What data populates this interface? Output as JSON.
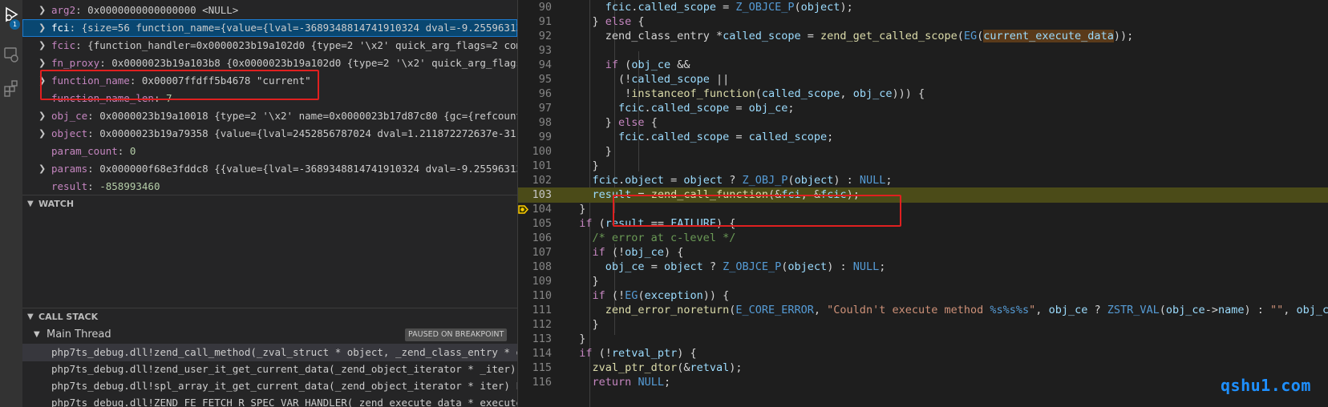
{
  "activity_bar": {
    "debug_badge_count": "1",
    "icons": [
      "run-debug-icon",
      "remote-explorer-icon",
      "extensions-icon"
    ]
  },
  "variables": [
    {
      "name": "arg2",
      "value": "0x0000000000000000 <NULL>",
      "expandable": true,
      "selected": false
    },
    {
      "name": "fci",
      "value": "{size=56 function_name={value={lval=-3689348814741910324 dval=-9.2559631349…",
      "expandable": true,
      "selected": true
    },
    {
      "name": "fcic",
      "value": "{function_handler=0x0000023b19a102d0 {type=2 '\\x2' quick_arg_flags=2 commo…",
      "expandable": true,
      "selected": false
    },
    {
      "name": "fn_proxy",
      "value": "0x0000023b19a103b8 {0x0000023b19a102d0 {type=2 '\\x2' quick_arg_flags=2…",
      "expandable": true,
      "selected": false
    },
    {
      "name": "function_name",
      "value": "0x00007ffdff5b4678 \"current\"",
      "expandable": true,
      "selected": false
    },
    {
      "name": "function_name_len",
      "value": "7",
      "expandable": false,
      "selected": false
    },
    {
      "name": "obj_ce",
      "value": "0x0000023b19a10018 {type=2 '\\x2' name=0x0000023b17d87c80 {gc={refcount=1…",
      "expandable": true,
      "selected": false
    },
    {
      "name": "object",
      "value": "0x0000023b19a79358 {value={lval=2452856787024 dval=1.211872272637e-311#D…",
      "expandable": true,
      "selected": false
    },
    {
      "name": "param_count",
      "value": "0",
      "expandable": false,
      "selected": false
    },
    {
      "name": "params",
      "value": "0x000000f68e3fddc8 {{value={lval=-3689348814741910324 dval=-9.2559631349…",
      "expandable": true,
      "selected": false
    },
    {
      "name": "result",
      "value": "-858993460",
      "expandable": false,
      "selected": false
    }
  ],
  "watch": {
    "title": "WATCH"
  },
  "call_stack": {
    "title": "CALL STACK",
    "thread": "Main Thread",
    "paused_label": "PAUSED ON BREAKPOINT",
    "frames": [
      "php7ts_debug.dll!zend_call_method(_zval_struct * object, _zend_class_entry * obj_",
      "php7ts_debug.dll!zend_user_it_get_current_data(_zend_object_iterator * _iter) Lin",
      "php7ts_debug.dll!spl_array_it_get_current_data(_zend_object_iterator * iter) Line",
      "php7ts_debug.dll!ZEND_FE_FETCH_R_SPEC_VAR_HANDLER(_zend_execute_data * execute_da"
    ]
  },
  "editor": {
    "current_line": 103,
    "lines": [
      {
        "n": 90,
        "indent": 6,
        "tokens": [
          [
            "id",
            "fcic"
          ],
          [
            "p",
            "."
          ],
          [
            "id",
            "called_scope"
          ],
          [
            "p",
            " = "
          ],
          [
            "mac",
            "Z_OBJCE_P"
          ],
          [
            "p",
            "("
          ],
          [
            "id",
            "object"
          ],
          [
            "p",
            ");"
          ]
        ]
      },
      {
        "n": 91,
        "indent": 4,
        "tokens": [
          [
            "p",
            "} "
          ],
          [
            "kw",
            "else"
          ],
          [
            "p",
            " {"
          ]
        ]
      },
      {
        "n": 92,
        "indent": 6,
        "tokens": [
          [
            "p",
            "zend_class_entry "
          ],
          [
            "p",
            "*"
          ],
          [
            "id",
            "called_scope"
          ],
          [
            "p",
            " = "
          ],
          [
            "fn",
            "zend_get_called_scope"
          ],
          [
            "p",
            "("
          ],
          [
            "mac",
            "EG"
          ],
          [
            "p",
            "("
          ],
          [
            "hlid",
            "current_execute_data"
          ],
          [
            "p",
            "));"
          ]
        ]
      },
      {
        "n": 93,
        "indent": 0,
        "tokens": []
      },
      {
        "n": 94,
        "indent": 6,
        "tokens": [
          [
            "kw",
            "if"
          ],
          [
            "p",
            " ("
          ],
          [
            "id",
            "obj_ce"
          ],
          [
            "p",
            " &&"
          ]
        ]
      },
      {
        "n": 95,
        "indent": 8,
        "tokens": [
          [
            "p",
            "(!"
          ],
          [
            "id",
            "called_scope"
          ],
          [
            "p",
            " ||"
          ]
        ]
      },
      {
        "n": 96,
        "indent": 9,
        "tokens": [
          [
            "p",
            "!"
          ],
          [
            "fn",
            "instanceof_function"
          ],
          [
            "p",
            "("
          ],
          [
            "id",
            "called_scope"
          ],
          [
            "p",
            ", "
          ],
          [
            "id",
            "obj_ce"
          ],
          [
            "p",
            "))) {"
          ]
        ]
      },
      {
        "n": 97,
        "indent": 8,
        "tokens": [
          [
            "id",
            "fcic"
          ],
          [
            "p",
            "."
          ],
          [
            "id",
            "called_scope"
          ],
          [
            "p",
            " = "
          ],
          [
            "id",
            "obj_ce"
          ],
          [
            "p",
            ";"
          ]
        ]
      },
      {
        "n": 98,
        "indent": 6,
        "tokens": [
          [
            "p",
            "} "
          ],
          [
            "kw",
            "else"
          ],
          [
            "p",
            " {"
          ]
        ]
      },
      {
        "n": 99,
        "indent": 8,
        "tokens": [
          [
            "id",
            "fcic"
          ],
          [
            "p",
            "."
          ],
          [
            "id",
            "called_scope"
          ],
          [
            "p",
            " = "
          ],
          [
            "id",
            "called_scope"
          ],
          [
            "p",
            ";"
          ]
        ]
      },
      {
        "n": 100,
        "indent": 6,
        "tokens": [
          [
            "p",
            "}"
          ]
        ]
      },
      {
        "n": 101,
        "indent": 4,
        "tokens": [
          [
            "p",
            "}"
          ]
        ]
      },
      {
        "n": 102,
        "indent": 4,
        "tokens": [
          [
            "id",
            "fcic"
          ],
          [
            "p",
            "."
          ],
          [
            "id",
            "object"
          ],
          [
            "p",
            " = "
          ],
          [
            "id",
            "object"
          ],
          [
            "p",
            " ? "
          ],
          [
            "mac",
            "Z_OBJ_P"
          ],
          [
            "p",
            "("
          ],
          [
            "id",
            "object"
          ],
          [
            "p",
            ") : "
          ],
          [
            "mac",
            "NULL"
          ],
          [
            "p",
            ";"
          ]
        ]
      },
      {
        "n": 103,
        "indent": 4,
        "tokens": [
          [
            "id",
            "result"
          ],
          [
            "p",
            " = "
          ],
          [
            "fn",
            "zend_call_function"
          ],
          [
            "p",
            "(&"
          ],
          [
            "id",
            "fci"
          ],
          [
            "p",
            ", &"
          ],
          [
            "id",
            "fcic"
          ],
          [
            "p",
            ");"
          ]
        ]
      },
      {
        "n": 104,
        "indent": 2,
        "tokens": [
          [
            "p",
            "}"
          ]
        ]
      },
      {
        "n": 105,
        "indent": 2,
        "tokens": [
          [
            "kw",
            "if"
          ],
          [
            "p",
            " ("
          ],
          [
            "id",
            "result"
          ],
          [
            "p",
            " == "
          ],
          [
            "id",
            "FAILURE"
          ],
          [
            "p",
            ") {"
          ]
        ]
      },
      {
        "n": 106,
        "indent": 4,
        "tokens": [
          [
            "cm",
            "/* error at c-level */"
          ]
        ]
      },
      {
        "n": 107,
        "indent": 4,
        "tokens": [
          [
            "kw",
            "if"
          ],
          [
            "p",
            " (!"
          ],
          [
            "id",
            "obj_ce"
          ],
          [
            "p",
            ") {"
          ]
        ]
      },
      {
        "n": 108,
        "indent": 6,
        "tokens": [
          [
            "id",
            "obj_ce"
          ],
          [
            "p",
            " = "
          ],
          [
            "id",
            "object"
          ],
          [
            "p",
            " ? "
          ],
          [
            "mac",
            "Z_OBJCE_P"
          ],
          [
            "p",
            "("
          ],
          [
            "id",
            "object"
          ],
          [
            "p",
            ") : "
          ],
          [
            "mac",
            "NULL"
          ],
          [
            "p",
            ";"
          ]
        ]
      },
      {
        "n": 109,
        "indent": 4,
        "tokens": [
          [
            "p",
            "}"
          ]
        ]
      },
      {
        "n": 110,
        "indent": 4,
        "tokens": [
          [
            "kw",
            "if"
          ],
          [
            "p",
            " (!"
          ],
          [
            "mac",
            "EG"
          ],
          [
            "p",
            "("
          ],
          [
            "id",
            "exception"
          ],
          [
            "p",
            ")) {"
          ]
        ]
      },
      {
        "n": 111,
        "indent": 6,
        "tokens": [
          [
            "fn",
            "zend_error_noreturn"
          ],
          [
            "p",
            "("
          ],
          [
            "mac",
            "E_CORE_ERROR"
          ],
          [
            "p",
            ", "
          ],
          [
            "str",
            "\"Couldn't execute method "
          ],
          [
            "mac",
            "%s%s%s"
          ],
          [
            "str",
            "\""
          ],
          [
            "p",
            ", "
          ],
          [
            "id",
            "obj_ce"
          ],
          [
            "p",
            " ? "
          ],
          [
            "mac",
            "ZSTR_VAL"
          ],
          [
            "p",
            "("
          ],
          [
            "id",
            "obj_ce"
          ],
          [
            "p",
            "->"
          ],
          [
            "id",
            "name"
          ],
          [
            "p",
            ") : "
          ],
          [
            "str",
            "\"\""
          ],
          [
            "p",
            ", "
          ],
          [
            "id",
            "obj_c"
          ]
        ]
      },
      {
        "n": 112,
        "indent": 4,
        "tokens": [
          [
            "p",
            "}"
          ]
        ]
      },
      {
        "n": 113,
        "indent": 2,
        "tokens": [
          [
            "p",
            "}"
          ]
        ]
      },
      {
        "n": 114,
        "indent": 2,
        "tokens": [
          [
            "kw",
            "if"
          ],
          [
            "p",
            " (!"
          ],
          [
            "id",
            "retval_ptr"
          ],
          [
            "p",
            ") {"
          ]
        ]
      },
      {
        "n": 115,
        "indent": 4,
        "tokens": [
          [
            "fn",
            "zval_ptr_dtor"
          ],
          [
            "p",
            "(&"
          ],
          [
            "id",
            "retval"
          ],
          [
            "p",
            ");"
          ]
        ]
      },
      {
        "n": 116,
        "indent": 4,
        "tokens": [
          [
            "kw",
            "return"
          ],
          [
            "p",
            " "
          ],
          [
            "mac",
            "NULL"
          ],
          [
            "p",
            ";"
          ]
        ]
      }
    ]
  },
  "watermark": "qshu1.com",
  "colors": {
    "panel": "#252526",
    "editor": "#1e1e1e",
    "selection": "#094771",
    "current_line": "#4b4b18",
    "annotation_box": "#e02020",
    "watermark": "#1e90ff"
  }
}
